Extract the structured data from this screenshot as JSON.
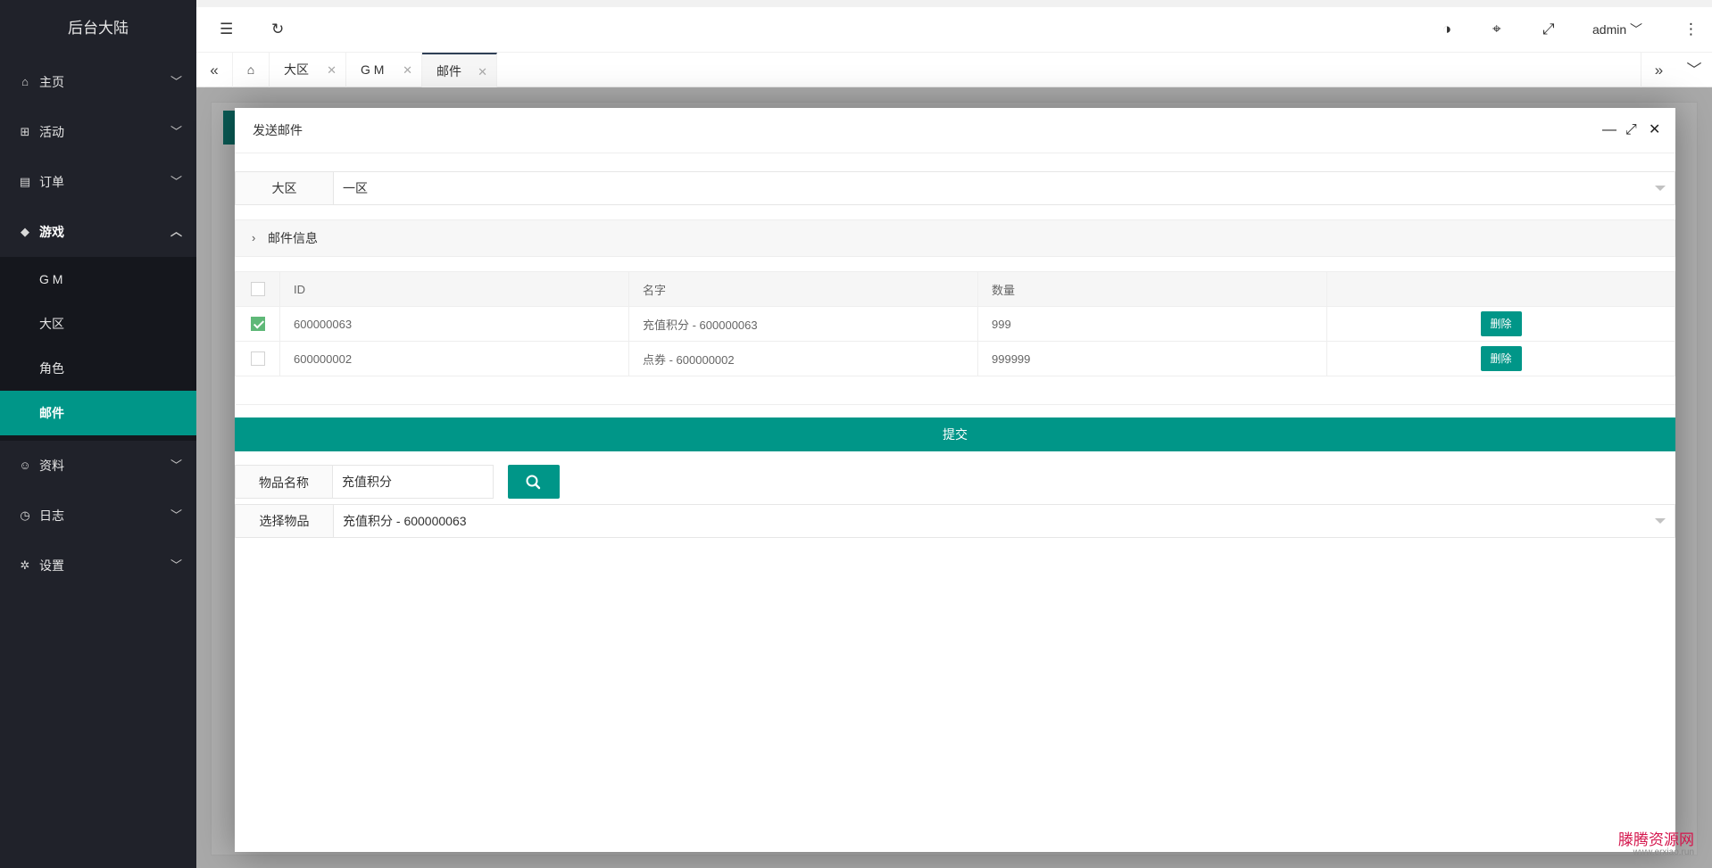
{
  "brand": "后台大陆",
  "sidebar": {
    "items": [
      {
        "label": "主页",
        "icon": "home-icon"
      },
      {
        "label": "活动",
        "icon": "gift-icon"
      },
      {
        "label": "订单",
        "icon": "clipboard-icon"
      },
      {
        "label": "游戏",
        "icon": "diamond-icon"
      },
      {
        "label": "资料",
        "icon": "user-icon"
      },
      {
        "label": "日志",
        "icon": "clock-icon"
      },
      {
        "label": "设置",
        "icon": "gear-icon"
      }
    ],
    "game_sub": [
      "G M",
      "大区",
      "角色",
      "邮件"
    ]
  },
  "header": {
    "user": "admin"
  },
  "tabs": [
    {
      "label": "大区"
    },
    {
      "label": "G M"
    },
    {
      "label": "邮件"
    }
  ],
  "modal": {
    "title": "发送邮件",
    "region_label": "大区",
    "region_value": "一区",
    "collapse_label": "邮件信息",
    "table": {
      "headers": [
        "ID",
        "名字",
        "数量",
        ""
      ],
      "rows": [
        {
          "id": "600000063",
          "name": "充值积分 - 600000063",
          "qty": "999",
          "checked": true,
          "action": "删除"
        },
        {
          "id": "600000002",
          "name": "点券 - 600000002",
          "qty": "999999",
          "checked": false,
          "action": "删除"
        }
      ]
    },
    "submit_label": "提交",
    "item_name_label": "物品名称",
    "item_name_value": "充值积分",
    "select_item_label": "选择物品",
    "select_item_value": "充值积分 - 600000063"
  },
  "watermark": {
    "line1": "滕腾资源网",
    "line2": "www.erxiao.run"
  },
  "colors": {
    "accent": "#009688",
    "sidebar_bg": "#20222a",
    "checked": "#5fb878"
  }
}
